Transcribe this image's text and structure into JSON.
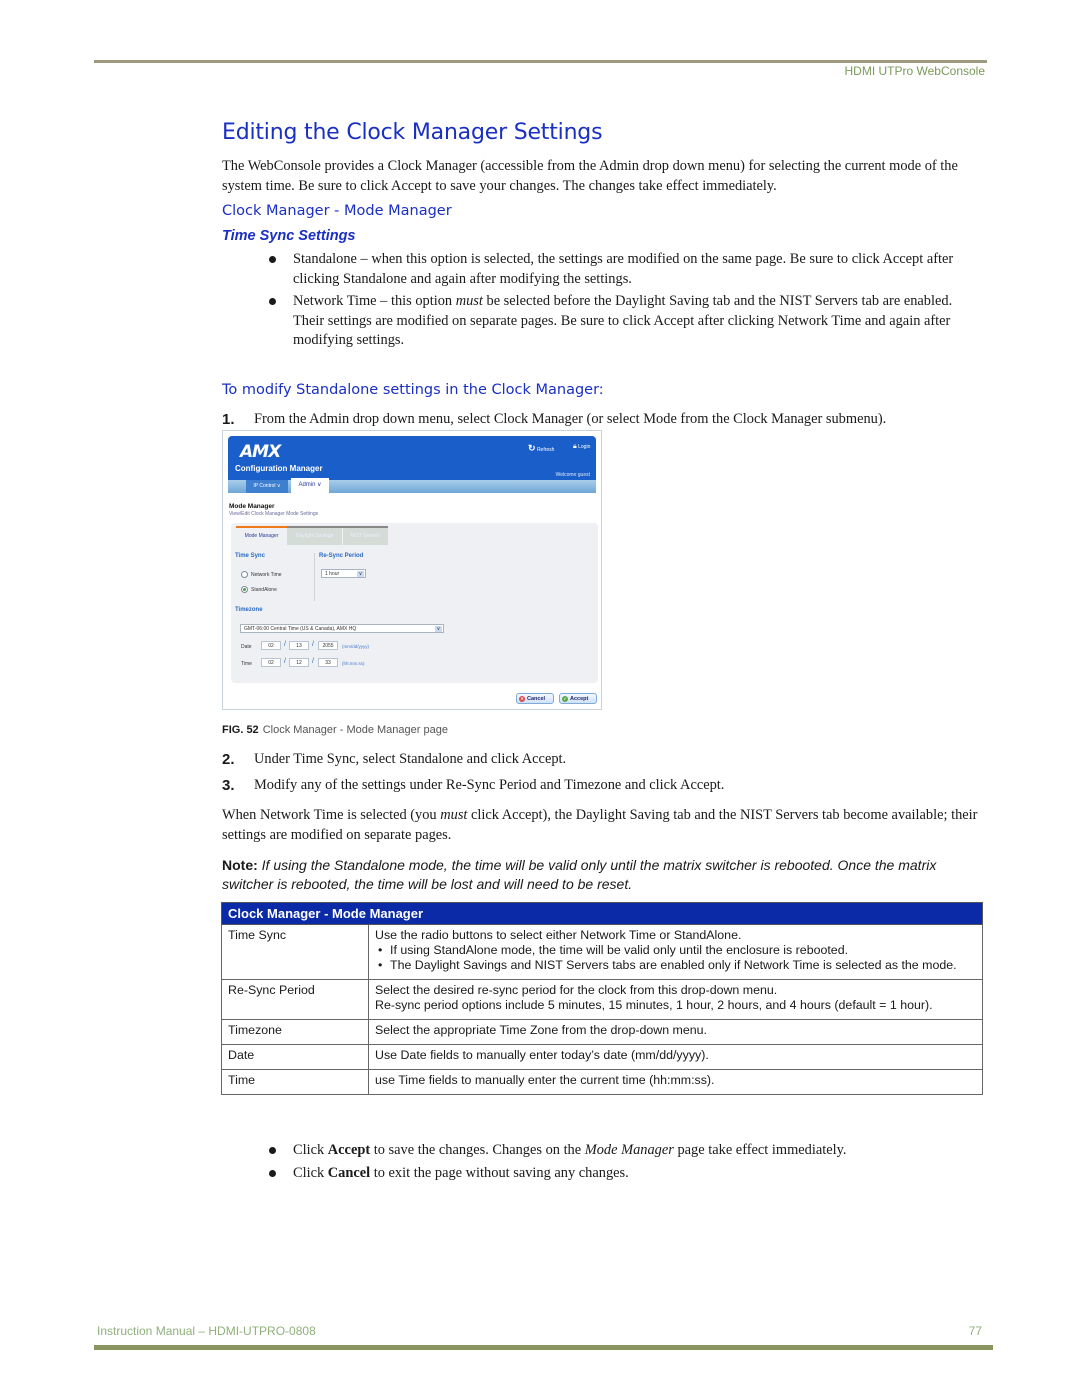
{
  "header": {
    "running_head": "HDMI UTPro WebConsole"
  },
  "title": "Editing the Clock Manager Settings",
  "intro": "The WebConsole provides a Clock Manager (accessible from the Admin drop down menu) for selecting the current mode of the system time. Be sure to click Accept to save your changes. The changes take effect immediately.",
  "section_heading": "Clock Manager - Mode Manager",
  "subsection_heading": "Time Sync Settings",
  "time_sync_bullets": [
    {
      "pre": "Standalone – when this option is selected, the settings are modified on the same page. Be sure to click Accept after clicking Standalone and again after modifying the settings.",
      "em": "",
      "post": ""
    },
    {
      "pre": " Network Time – this option ",
      "em": "must",
      "post": " be selected before the Daylight Saving tab and the NIST Servers tab are enabled. Their settings are modified on separate pages. Be sure to click Accept after clicking Network Time and again after modifying settings."
    }
  ],
  "procedure_heading": "To modify Standalone settings in the Clock Manager:",
  "steps": [
    {
      "num": "1.",
      "text": "From the Admin drop down menu, select Clock Manager (or select Mode from the Clock Manager submenu)."
    },
    {
      "num": "2.",
      "text": "Under Time Sync, select Standalone and click Accept."
    },
    {
      "num": "3.",
      "text": "Modify any of the settings under Re-Sync Period and Timezone and click Accept."
    }
  ],
  "figure": {
    "logo": "AMX",
    "app_title": "Configuration Manager",
    "refresh_label": "Refresh",
    "login_label": "Login",
    "welcome": "Welcome guest",
    "nav": {
      "ip_control": "IP Control ∨",
      "admin": "Admin ∨"
    },
    "page_title": "Mode Manager",
    "page_subtitle": "View/Edit Clock Manager Mode Settings",
    "tabs": [
      "Mode Manager",
      "Daylight Savings",
      "NIST Servers"
    ],
    "time_sync_label": "Time Sync",
    "resync_label": "Re-Sync Period",
    "radio_network": "Network Time",
    "radio_standalone": "StandAlone",
    "selected_mode": "StandAlone",
    "resync_value": "1 hour",
    "timezone_label": "Timezone",
    "timezone_value": "GMT-06:00 Central Time (US & Canada), AMX HQ",
    "date_label": "Date",
    "date": {
      "mm": "02",
      "dd": "13",
      "yyyy": "2055",
      "hint": "(mm/dd/yyyy)"
    },
    "time_label": "Time",
    "time": {
      "hh": "02",
      "mm": "12",
      "ss": "33",
      "hint": "(hh:mm:ss)"
    },
    "slash": "/",
    "cancel_label": "Cancel",
    "accept_label": "Accept",
    "caption_num": "FIG. 52",
    "caption_text": "Clock Manager - Mode Manager page"
  },
  "network_paragraph": {
    "pre": "When Network Time is selected (you ",
    "em": "must",
    "post": " click Accept), the Daylight Saving tab and the NIST Servers tab become available; their settings are modified on separate pages."
  },
  "note": {
    "label": "Note:",
    "text": " If using the Standalone mode, the time will be valid only until the matrix switcher is rebooted. Once the matrix switcher is rebooted, the time will be lost and will need to be reset."
  },
  "table": {
    "header": "Clock Manager - Mode Manager",
    "rows": [
      {
        "key": "Time Sync",
        "lines": [
          "Use the radio buttons to select either Network Time or StandAlone."
        ],
        "bullets": [
          "If using StandAlone mode, the time will be valid only until the enclosure is rebooted.",
          "The Daylight Savings and NIST Servers tabs are enabled only if Network Time is selected as the mode."
        ]
      },
      {
        "key": "Re-Sync Period",
        "lines": [
          "Select the desired re-sync period for the clock from this drop-down menu.",
          "Re-sync period options include 5 minutes, 15 minutes, 1 hour, 2 hours, and 4 hours (default = 1 hour)."
        ],
        "bullets": []
      },
      {
        "key": "Timezone",
        "lines": [
          "Select the appropriate Time Zone from the drop-down menu."
        ],
        "bullets": []
      },
      {
        "key": "Date",
        "lines": [
          "Use Date fields to manually enter today’s date (mm/dd/yyyy)."
        ],
        "bullets": []
      },
      {
        "key": "Time",
        "lines": [
          "use Time fields to manually enter the current time (hh:mm:ss)."
        ],
        "bullets": []
      }
    ]
  },
  "closing_bullets": [
    {
      "pre": "Click ",
      "bold": "Accept",
      "mid": " to save the changes. Changes on the ",
      "em": "Mode Manager",
      "post": " page take effect immediately."
    },
    {
      "pre": "Click ",
      "bold": "Cancel",
      "mid": " to exit the page without saving any changes.",
      "em": "",
      "post": ""
    }
  ],
  "footer": {
    "left": "Instruction Manual – HDMI-UTPRO-0808",
    "page_number": "77"
  },
  "colors": {
    "heading_blue": "#1a2fc4",
    "table_header_bg": "#0a2aa8",
    "rule_olive": "#8a9460",
    "footer_green": "#8fb07a"
  }
}
